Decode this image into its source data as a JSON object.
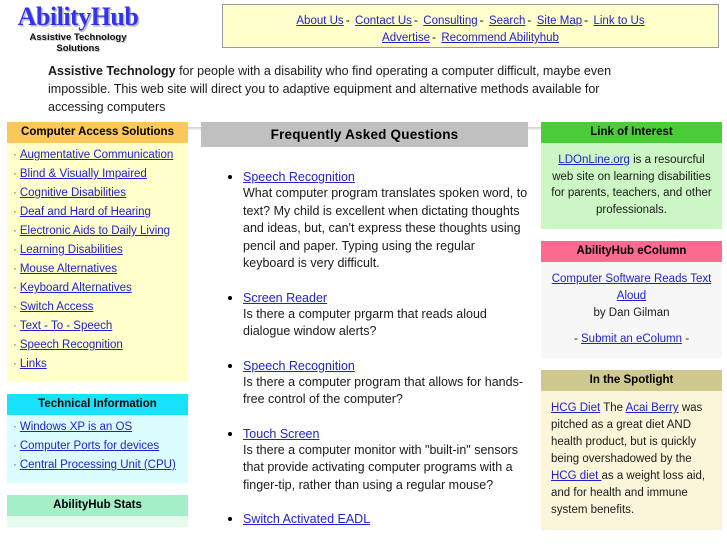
{
  "branding": {
    "logo_word": "AbilityHub",
    "logo_subtitle_line1": "Assistive Technology",
    "logo_subtitle_line2": "Solutions",
    "logo_color": "#3333ee"
  },
  "topnav": {
    "row1": [
      "About Us",
      "Contact Us",
      "Consulting",
      "Search",
      "Site Map",
      "Link to Us"
    ],
    "row2": [
      "Advertise",
      "Recommend Abilityhub"
    ],
    "separator": "-"
  },
  "intro": {
    "lead": "Assistive Technology",
    "text": " for people with a disability who find operating a computer difficult, maybe even impossible. This web site will direct you to adaptive equipment and alternative methods available for accessing computers"
  },
  "sidebar": {
    "panels": [
      {
        "title": "Computer Access Solutions",
        "head_color": "#fdc75b",
        "body_color": "#ffffcc",
        "items": [
          "Augmentative Communication",
          "Blind & Visually Impaired",
          "Cognitive Disabilities",
          "Deaf and Hard of Hearing",
          "Electronic Aids to Daily Living",
          "Learning Disabilities",
          "Mouse Alternatives",
          "Keyboard Alternatives",
          "Switch Access",
          "Text - To - Speech",
          "Speech Recognition",
          "Links"
        ]
      },
      {
        "title": "Technical Information",
        "head_color": "#17e2fb",
        "body_color": "#dbfdff",
        "items": [
          "Windows XP is an OS",
          "Computer Ports for devices",
          "Central Processing Unit (CPU)"
        ]
      },
      {
        "title": "AbilityHub Stats",
        "head_color": "#a5efc8",
        "body_color": "#e4fbee",
        "items": []
      }
    ]
  },
  "faq": {
    "heading": "Frequently Asked Questions",
    "items": [
      {
        "link": "Speech Recognition",
        "answer": "What computer program translates spoken word, to text? My child is excellent when dictating thoughts and ideas, but, can't express these thoughts using pencil and paper. Typing using the regular keyboard is very difficult."
      },
      {
        "link": "Screen Reader",
        "answer": "Is there a computer prgarm that reads aloud dialogue window alerts?"
      },
      {
        "link": "Speech Recognition",
        "answer": "Is there a computer program that allows for hands-free control of the computer?"
      },
      {
        "link": "Touch Screen",
        "answer": "Is there a computer monitor with \"built-in\" sensors that provide activating computer programs with a finger-tip, rather than using a regular mouse?"
      },
      {
        "link": "Switch Activated EADL",
        "answer": ""
      }
    ]
  },
  "right": {
    "link_of_interest": {
      "title": "Link of Interest",
      "head_color": "#4bcd38",
      "body_color": "#ccf7c4",
      "link_text": "LDOnLine.org",
      "body_text": " is a resourcful web site on learning disabilities for parents, teachers, and other professionals."
    },
    "ecolumn": {
      "title": "AbilityHub eColumn",
      "head_color": "#fd6a8f",
      "body_color": "#f7f7f7",
      "article_link": "Computer Software Reads Text Aloud",
      "byline": "by Dan Gilman",
      "submit_prefix": "- ",
      "submit_link": "Submit an eColumn",
      "submit_suffix": " -"
    },
    "spotlight": {
      "title": "In the Spotlight",
      "head_color": "#cfc98f",
      "body_color": "#fbf6da",
      "link1": "HCG Diet",
      "text1": " The ",
      "link2": "Acai Berry",
      "text2": " was pitched as a great diet AND health product, but is quickly being overshadowed by the ",
      "link3": "HCG diet ",
      "text3": "as a weight loss aid, and for health and immune system benefits."
    }
  }
}
